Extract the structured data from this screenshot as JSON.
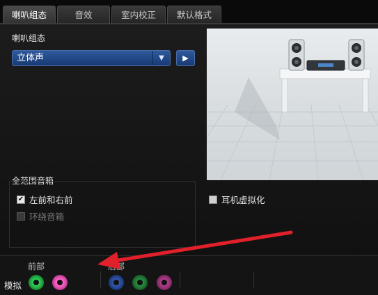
{
  "tabs": [
    {
      "label": "喇叭组态",
      "active": true
    },
    {
      "label": "音效",
      "active": false
    },
    {
      "label": "室内校正",
      "active": false
    },
    {
      "label": "默认格式",
      "active": false
    }
  ],
  "speaker_config": {
    "section_label": "喇叭组态",
    "selected": "立体声",
    "dropdown_icon": "chevron-down-icon",
    "play_icon": "play-icon"
  },
  "full_range": {
    "title": "全范围音箱",
    "options": [
      {
        "label": "左前和右前",
        "checked": true,
        "disabled": false
      },
      {
        "label": "环绕音箱",
        "checked": false,
        "disabled": true
      }
    ]
  },
  "headphone_virtualization": {
    "label": "耳机虚拟化",
    "checked": false
  },
  "analog": {
    "label": "模拟",
    "front_label": "前部",
    "rear_label": "后部",
    "front_jacks": [
      {
        "color": "#1f9a3a",
        "name": "green"
      },
      {
        "color": "#d0449f",
        "name": "pink"
      }
    ],
    "rear_jacks": [
      {
        "color": "#1f3f86",
        "name": "blue"
      },
      {
        "color": "#1d6a2e",
        "name": "green"
      },
      {
        "color": "#8a2d6c",
        "name": "pink"
      }
    ]
  },
  "colors": {
    "accent_blue": "#2f5a9c",
    "annotation_arrow": "#e0202a"
  }
}
